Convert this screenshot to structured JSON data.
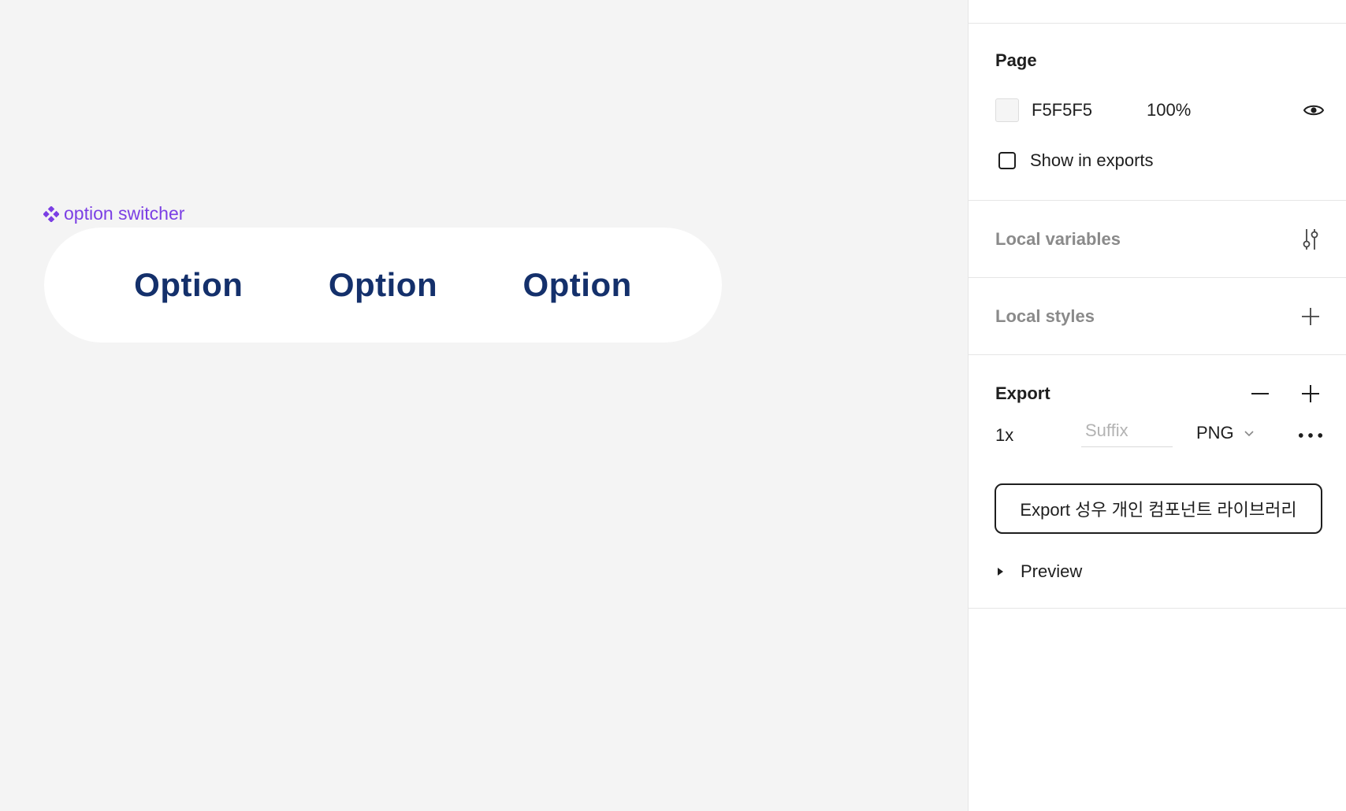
{
  "canvas": {
    "component_label": "option switcher",
    "options": [
      "Option",
      "Option",
      "Option"
    ],
    "background": "#F4F4F4"
  },
  "panel": {
    "page": {
      "title": "Page",
      "color_hex": "F5F5F5",
      "opacity": "100%",
      "show_in_exports_label": "Show in exports"
    },
    "local_variables": {
      "title": "Local variables"
    },
    "local_styles": {
      "title": "Local styles"
    },
    "export": {
      "title": "Export",
      "scale": "1x",
      "suffix_placeholder": "Suffix",
      "format": "PNG",
      "button_label": "Export 성우 개인 컴포넌트 라이브러리",
      "preview_label": "Preview"
    }
  },
  "colors": {
    "component_purple": "#7B3FE4",
    "option_text": "#14306B",
    "panel_text": "#1E1E1E",
    "muted_text": "#8A8A8A"
  }
}
